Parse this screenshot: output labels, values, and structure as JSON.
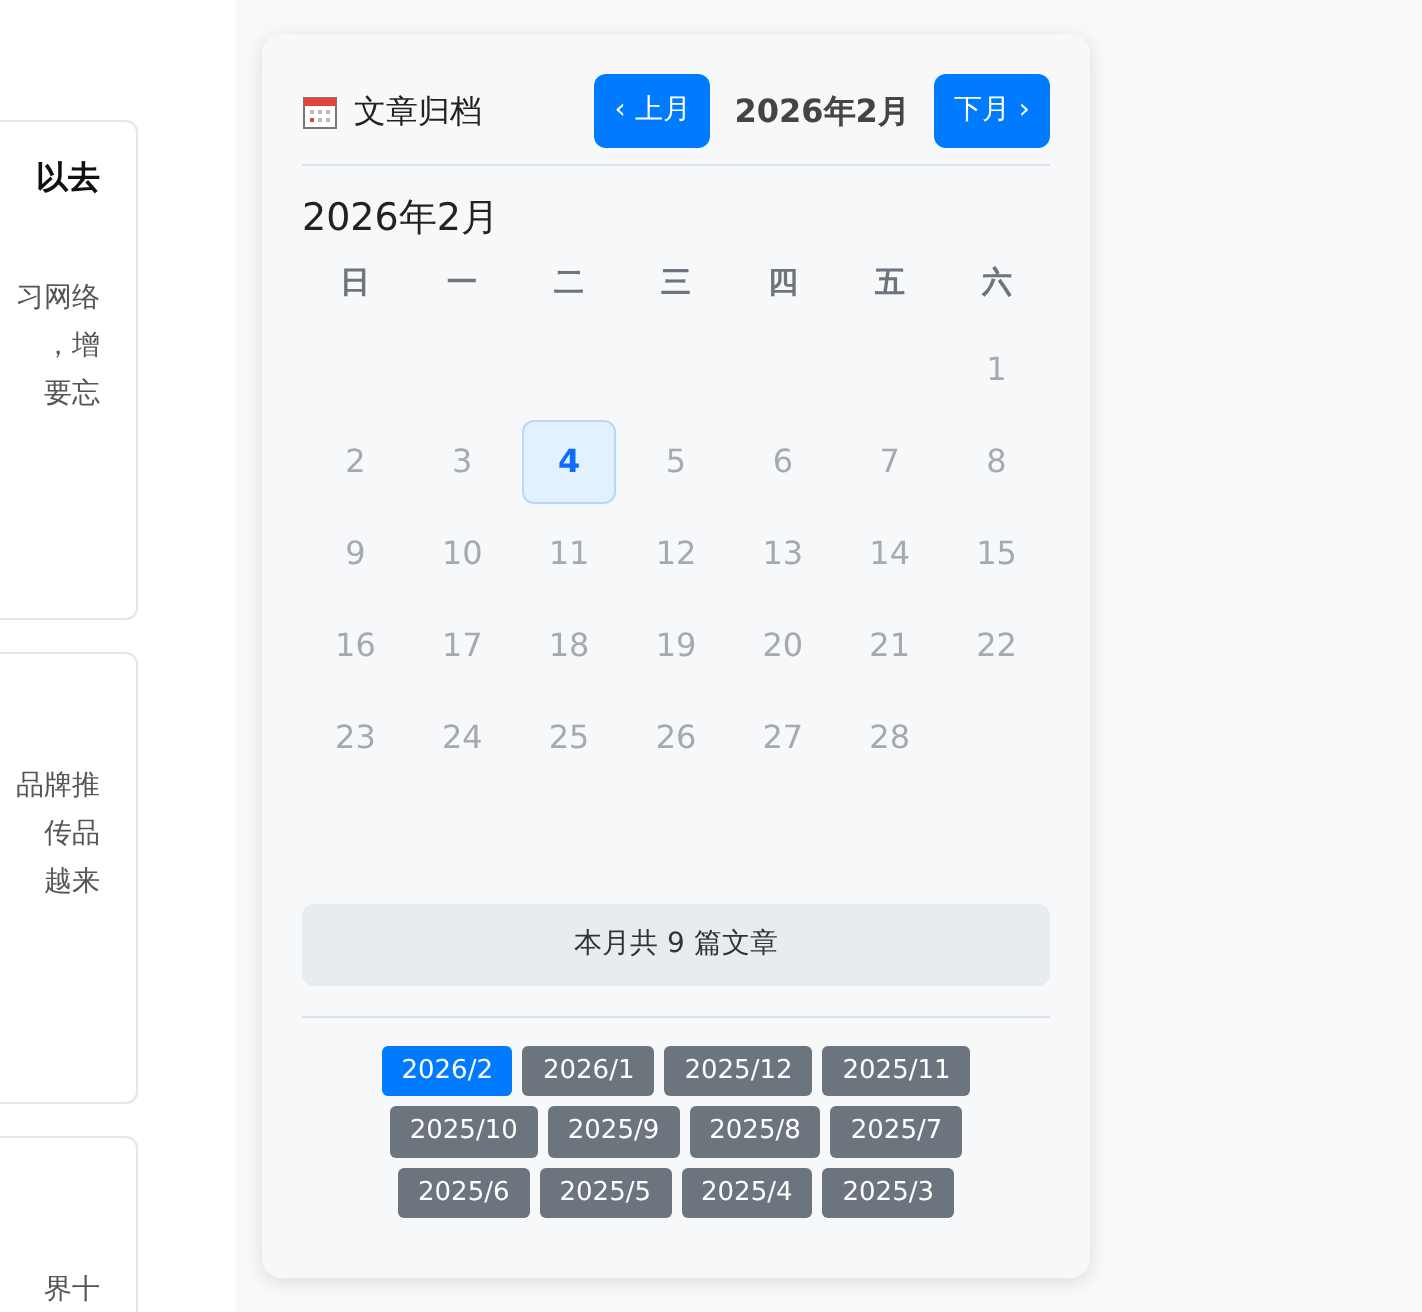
{
  "posts": [
    {
      "title": "以去",
      "lines": [
        "习网络",
        "，增",
        "要忘"
      ]
    },
    {
      "lines": [
        "品牌推",
        "传品",
        "越来"
      ]
    },
    {
      "lines": [
        "界十"
      ]
    }
  ],
  "archive": {
    "title": "文章归档",
    "prev": "‹ 上月",
    "current": "2026年2月",
    "next": "下月 ›",
    "calendar_title": "2026年2月",
    "weekdays": [
      "日",
      "一",
      "二",
      "三",
      "四",
      "五",
      "六"
    ],
    "weeks": [
      [
        {
          "kind": "blank"
        },
        {
          "kind": "blank"
        },
        {
          "kind": "blank"
        },
        {
          "kind": "blank"
        },
        {
          "kind": "blank"
        },
        {
          "kind": "blank"
        },
        {
          "kind": "day",
          "label": "1",
          "selected": false
        }
      ],
      [
        {
          "kind": "day",
          "label": "2",
          "selected": false
        },
        {
          "kind": "day",
          "label": "3",
          "selected": false
        },
        {
          "kind": "day",
          "label": "4",
          "selected": true
        },
        {
          "kind": "day",
          "label": "5",
          "selected": false
        },
        {
          "kind": "day",
          "label": "6",
          "selected": false
        },
        {
          "kind": "day",
          "label": "7",
          "selected": false
        },
        {
          "kind": "day",
          "label": "8",
          "selected": false
        }
      ],
      [
        {
          "kind": "day",
          "label": "9",
          "selected": false
        },
        {
          "kind": "day",
          "label": "10",
          "selected": false
        },
        {
          "kind": "day",
          "label": "11",
          "selected": false
        },
        {
          "kind": "day",
          "label": "12",
          "selected": false
        },
        {
          "kind": "day",
          "label": "13",
          "selected": false
        },
        {
          "kind": "day",
          "label": "14",
          "selected": false
        },
        {
          "kind": "day",
          "label": "15",
          "selected": false
        }
      ],
      [
        {
          "kind": "day",
          "label": "16",
          "selected": false
        },
        {
          "kind": "day",
          "label": "17",
          "selected": false
        },
        {
          "kind": "day",
          "label": "18",
          "selected": false
        },
        {
          "kind": "day",
          "label": "19",
          "selected": false
        },
        {
          "kind": "day",
          "label": "20",
          "selected": false
        },
        {
          "kind": "day",
          "label": "21",
          "selected": false
        },
        {
          "kind": "day",
          "label": "22",
          "selected": false
        }
      ],
      [
        {
          "kind": "day",
          "label": "23",
          "selected": false
        },
        {
          "kind": "day",
          "label": "24",
          "selected": false
        },
        {
          "kind": "day",
          "label": "25",
          "selected": false
        },
        {
          "kind": "day",
          "label": "26",
          "selected": false
        },
        {
          "kind": "day",
          "label": "27",
          "selected": false
        },
        {
          "kind": "day",
          "label": "28",
          "selected": false
        },
        {
          "kind": "blank"
        }
      ]
    ],
    "summary": "本月共 9 篇文章",
    "months": [
      {
        "label": "2026/2",
        "selected": true
      },
      {
        "label": "2026/1",
        "selected": false
      },
      {
        "label": "2025/12",
        "selected": false
      },
      {
        "label": "2025/11",
        "selected": false
      },
      {
        "label": "2025/10",
        "selected": false
      },
      {
        "label": "2025/9",
        "selected": false
      },
      {
        "label": "2025/8",
        "selected": false
      },
      {
        "label": "2025/7",
        "selected": false
      },
      {
        "label": "2025/6",
        "selected": false
      },
      {
        "label": "2025/5",
        "selected": false
      },
      {
        "label": "2025/4",
        "selected": false
      },
      {
        "label": "2025/3",
        "selected": false
      }
    ]
  }
}
